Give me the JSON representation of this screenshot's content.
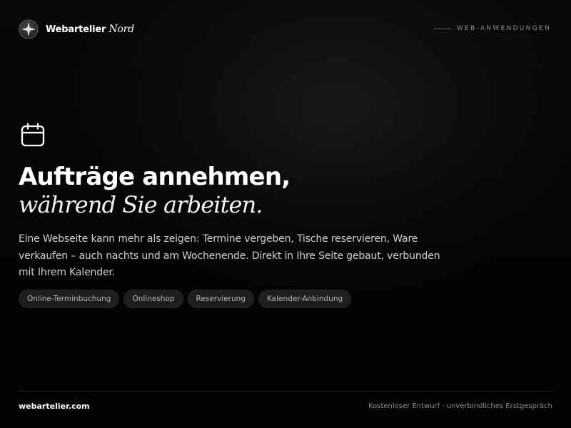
{
  "brand": {
    "name": "Webartelier",
    "accent": "Nord",
    "logo_icon": "compass-star-icon"
  },
  "header": {
    "tag": "WEB-ANWENDUNGEN"
  },
  "hero": {
    "icon": "calendar-icon",
    "headline_line1": "Aufträge annehmen,",
    "headline_line2": "während Sie arbeiten.",
    "lead": "Eine Webseite kann mehr als zeigen: Termine vergeben, Tische reservieren, Ware verkaufen – auch nachts und am Wochenende. Direkt in Ihre Seite gebaut, verbunden mit Ihrem Kalender.",
    "chips": [
      "Online-Terminbuchung",
      "Onlineshop",
      "Reservierung",
      "Kalender-Anbindung"
    ]
  },
  "footer": {
    "site": "webartelier.com",
    "note": "Kostenloser Entwurf · unverbindliches Erstgespräch"
  },
  "colors": {
    "background": "#050505",
    "text": "#ffffff",
    "muted": "#8c8c8c",
    "chip_background": "#1e1e1e"
  }
}
